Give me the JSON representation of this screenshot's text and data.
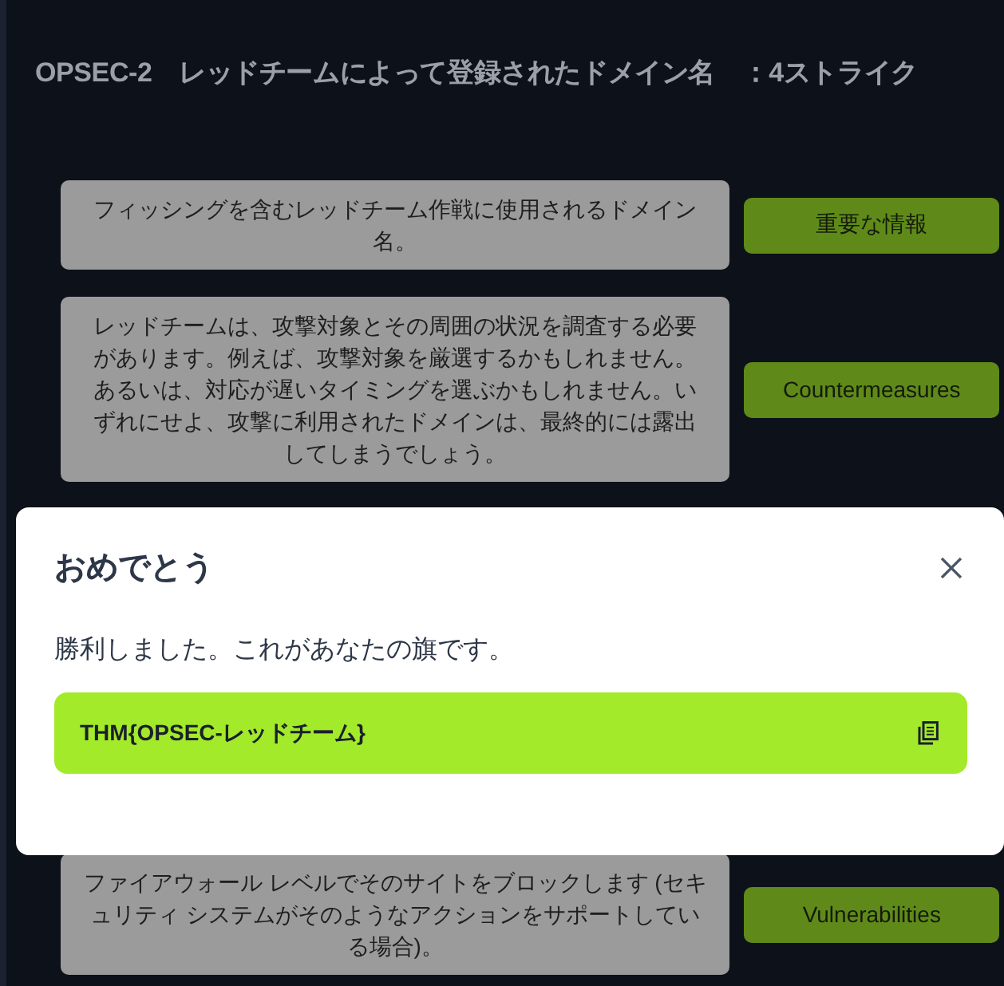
{
  "page": {
    "title": "OPSEC-2　レッドチームによって登録されたドメイン名　：4ストライク"
  },
  "rows": [
    {
      "description": "フィッシングを含むレッドチーム作戦に使用されるドメイン名。",
      "answer": "重要な情報"
    },
    {
      "description": "レッドチームは、攻撃対象とその周囲の状況を調査する必要があります。例えば、攻撃対象を厳選するかもしれません。あるいは、対応が遅いタイミングを選ぶかもしれません。いずれにせよ、攻撃に利用されたドメインは、最終的には露出してしまうでしょう。",
      "answer": "Countermeasures"
    },
    {
      "description": "ファイアウォール レベルでそのサイトをブロックします (セキュリティ システムがそのようなアクションをサポートしている場合)。",
      "answer": "Vulnerabilities"
    }
  ],
  "modal": {
    "title": "おめでとう",
    "message": "勝利しました。これがあなたの旗です。",
    "flag": "THM{OPSEC-レッドチーム}"
  }
}
